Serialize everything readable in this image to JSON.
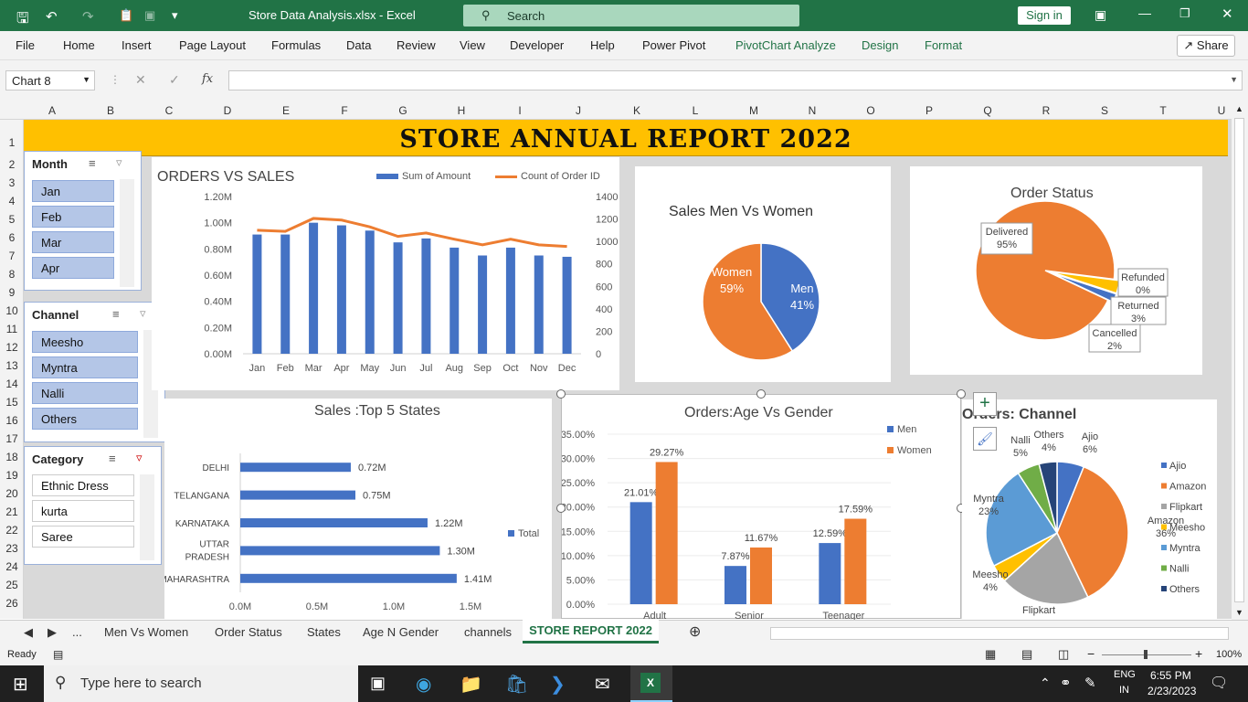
{
  "title_bar": {
    "file_title": "Store Data Analysis.xlsx - Excel",
    "search_placeholder": "Search",
    "sign_in": "Sign in"
  },
  "menu": [
    "File",
    "Home",
    "Insert",
    "Page Layout",
    "Formulas",
    "Data",
    "Review",
    "View",
    "Developer",
    "Help",
    "Power Pivot",
    "PivotChart Analyze",
    "Design",
    "Format"
  ],
  "share_label": "Share",
  "name_box": "Chart 8",
  "columns": [
    "A",
    "B",
    "C",
    "D",
    "E",
    "F",
    "G",
    "H",
    "I",
    "J",
    "K",
    "L",
    "M",
    "N",
    "O",
    "P",
    "Q",
    "R",
    "S",
    "T",
    "U"
  ],
  "rows": [
    "1",
    "2",
    "3",
    "4",
    "5",
    "6",
    "7",
    "8",
    "9",
    "10",
    "11",
    "12",
    "13",
    "14",
    "15",
    "16",
    "17",
    "18",
    "19",
    "20",
    "21",
    "22",
    "23",
    "24",
    "25",
    "26"
  ],
  "banner_title": "STORE ANNUAL REPORT 2022",
  "slicers": {
    "month": {
      "title": "Month",
      "items": [
        "Jan",
        "Feb",
        "Mar",
        "Apr"
      ]
    },
    "channel": {
      "title": "Channel",
      "items": [
        "Meesho",
        "Myntra",
        "Nalli",
        "Others"
      ]
    },
    "category": {
      "title": "Category",
      "items": [
        "Ethnic Dress",
        "kurta",
        "Saree"
      ]
    }
  },
  "chart_data": [
    {
      "type": "bar",
      "title": "ORDERS VS SALES",
      "categories": [
        "Jan",
        "Feb",
        "Mar",
        "Apr",
        "May",
        "Jun",
        "Jul",
        "Aug",
        "Sep",
        "Oct",
        "Nov",
        "Dec"
      ],
      "series": [
        {
          "name": "Sum of Amount",
          "type": "bar",
          "axis": "left",
          "values": [
            0.91,
            0.91,
            1.0,
            0.98,
            0.94,
            0.85,
            0.88,
            0.81,
            0.75,
            0.81,
            0.75,
            0.74
          ]
        },
        {
          "name": "Count of Order ID",
          "type": "line",
          "axis": "right",
          "values": [
            1100,
            1090,
            1205,
            1190,
            1130,
            1045,
            1075,
            1020,
            970,
            1020,
            970,
            955
          ]
        }
      ],
      "left_ticks": [
        "0.00M",
        "0.20M",
        "0.40M",
        "0.60M",
        "0.80M",
        "1.00M",
        "1.20M"
      ],
      "right_ticks": [
        "0",
        "200",
        "400",
        "600",
        "800",
        "1000",
        "1200",
        "1400"
      ],
      "ylim_left": [
        0,
        1.2
      ],
      "ylim_right": [
        0,
        1400
      ],
      "colors": {
        "bar": "#4472c4",
        "line": "#ed7d31"
      }
    },
    {
      "type": "pie",
      "title": "Sales Men Vs Women",
      "slices": [
        {
          "label": "Men",
          "value": 41,
          "text": "41%",
          "color": "#4472c4"
        },
        {
          "label": "Women",
          "value": 59,
          "text": "59%",
          "color": "#ed7d31"
        }
      ]
    },
    {
      "type": "pie",
      "title": "Order Status",
      "slices": [
        {
          "label": "Delivered",
          "value": 95,
          "text": "95%",
          "color": "#ed7d31"
        },
        {
          "label": "Refunded",
          "value": 0,
          "text": "0%",
          "color": "#a5a5a5"
        },
        {
          "label": "Returned",
          "value": 3,
          "text": "3%",
          "color": "#ffc000"
        },
        {
          "label": "Cancelled",
          "value": 2,
          "text": "2%",
          "color": "#4472c4"
        }
      ]
    },
    {
      "type": "bar",
      "orientation": "horizontal",
      "title": "Sales :Top 5 States",
      "categories": [
        "DELHI",
        "TELANGANA",
        "KARNATAKA",
        "UTTAR PRADESH",
        "MAHARASHTRA"
      ],
      "values": [
        0.72,
        0.75,
        1.22,
        1.3,
        1.41
      ],
      "value_labels": [
        "0.72M",
        "0.75M",
        "1.22M",
        "1.30M",
        "1.41M"
      ],
      "x_ticks": [
        "0.0M",
        "0.5M",
        "1.0M",
        "1.5M"
      ],
      "xlim": [
        0,
        1.5
      ],
      "legend": [
        "Total"
      ],
      "color": "#4472c4"
    },
    {
      "type": "bar",
      "title": "Orders:Age Vs Gender",
      "categories": [
        "Adult",
        "Senior",
        "Teenager"
      ],
      "series": [
        {
          "name": "Men",
          "values": [
            21.01,
            7.87,
            12.59
          ],
          "labels": [
            "21.01%",
            "7.87%",
            "12.59%"
          ],
          "color": "#4472c4"
        },
        {
          "name": "Women",
          "values": [
            29.27,
            11.67,
            17.59
          ],
          "labels": [
            "29.27%",
            "11.67%",
            "17.59%"
          ],
          "color": "#ed7d31"
        }
      ],
      "y_ticks": [
        "0.00%",
        "5.00%",
        "10.00%",
        "15.00%",
        "20.00%",
        "25.00%",
        "30.00%",
        "35.00%"
      ],
      "ylim": [
        0,
        35
      ]
    },
    {
      "type": "pie",
      "title": "Orders: Channel",
      "slices": [
        {
          "label": "Ajio",
          "value": 6,
          "text": "6%",
          "color": "#4472c4"
        },
        {
          "label": "Amazon",
          "value": 36,
          "text": "36%",
          "color": "#ed7d31"
        },
        {
          "label": "Flipkart",
          "value": 20,
          "text": "",
          "color": "#a5a5a5"
        },
        {
          "label": "Meesho",
          "value": 4,
          "text": "4%",
          "color": "#ffc000"
        },
        {
          "label": "Myntra",
          "value": 23,
          "text": "23%",
          "color": "#5b9bd5"
        },
        {
          "label": "Nalli",
          "value": 5,
          "text": "5%",
          "color": "#70ad47"
        },
        {
          "label": "Others",
          "value": 4,
          "text": "4%",
          "color": "#264478"
        }
      ]
    }
  ],
  "sheet_tabs": [
    "...",
    "Men Vs Women",
    "Order Status",
    "States",
    "Age N Gender",
    "channels",
    "STORE REPORT 2022"
  ],
  "status": {
    "ready": "Ready",
    "zoom": "100%"
  },
  "taskbar": {
    "search_placeholder": "Type here to search",
    "lang1": "ENG",
    "lang2": "IN",
    "time": "6:55 PM",
    "date": "2/23/2023"
  }
}
